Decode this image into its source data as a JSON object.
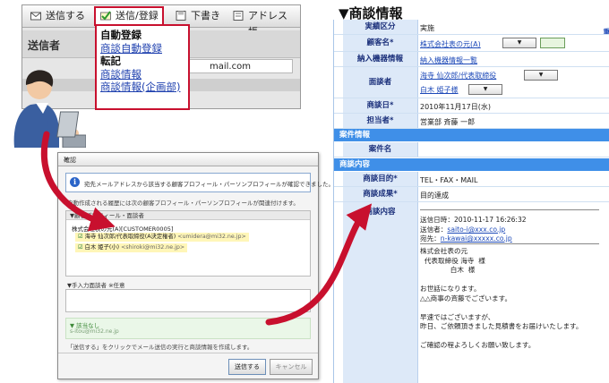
{
  "mail_client": {
    "toolbar": {
      "send": "送信する",
      "send_register": "送信/登録",
      "draft": "下書き",
      "address_book": "アドレス帳"
    },
    "sender_label": "送信者",
    "address_fragment": "mail.com",
    "dropdown": {
      "auto_header": "自動登録",
      "auto_item": "商談自動登録",
      "transfer_header": "転記",
      "transfer_item1": "商談情報",
      "transfer_item2": "商談情報(企画部)"
    }
  },
  "dialog": {
    "title": "確認",
    "close": "×",
    "info_text": "宛先メールアドレスから該当する顧客プロフィール・パーソンプロフィールが確認できました。",
    "note": "自動作成される履歴には次の顧客プロフィール・パーソンプロフィールが関連付けます。",
    "section1_title": "▼顧客プロフィール・面談者",
    "company": "株式会社表の元(A)[CUSTOMER0005]",
    "person1": "海寺 仙次郎/代表取締役(A決定権者)",
    "person1_email": "<umidera@mi32.ne.jp>",
    "person2": "白木 姫子(小)",
    "person2_email": "<shiroki@mi32.ne.jp>",
    "section2_title": "▼手入力面談者 ※任意",
    "unmatched_title": "▼ 該当なし",
    "unmatched_email": "s-itou@mi32.ne.jp",
    "footer": "「送信する」をクリックでメール送信の実行と商談情報を作成します。",
    "send_button": "送信する",
    "cancel_button": "キャンセル"
  },
  "panel": {
    "title": "▼商談情報",
    "side_link": "重",
    "rows": {
      "category_key": "実績区分",
      "category_val": "実施",
      "customer_key": "顧客名*",
      "customer_val": "株式会社表の元(A)",
      "product_key": "納入機器情報",
      "product_val": "納入機器情報一覧",
      "person_key": "面談者",
      "person1_val": "海寺 仙次郎/代表取締役",
      "person2_val": "白木 姫子様",
      "date_key": "商談日*",
      "date_val": "2010年11月17日(水)",
      "owner_key": "担当者*",
      "owner_val": "営業部 斉藤 一郎",
      "case_section": "案件情報",
      "case_key": "案件名",
      "detail_section": "商談内容",
      "purpose_key": "商談目的*",
      "purpose_val": "TEL・FAX・MAIL",
      "result_key": "商談成果*",
      "result_val": "目的達成",
      "content_key": "商談内容"
    },
    "content": {
      "sent_at": "送信日時：2010-11-17 16:26:32",
      "from_label": "送信者：",
      "from_email": "saito-i@xxx.co.jp",
      "to_label": "宛先：",
      "to_email": "n-kawai@xxxxx.co.jp",
      "body": "株式会社表の元\n  代表取締役 海寺  様\n              白木  様\n\nお世話になります。\n△△商事の斉藤でございます。\n\n早速ではございますが、\n昨日、ご依頼頂きました見積書をお届けいたします。\n\nご確認の程よろしくお願い致します。"
    }
  },
  "colors": {
    "accent_red": "#c8102e",
    "panel_blue": "#3f8fe8",
    "label_bg": "#dde9f8",
    "link_blue": "#1d49b8",
    "arrow": "#c8102e"
  }
}
